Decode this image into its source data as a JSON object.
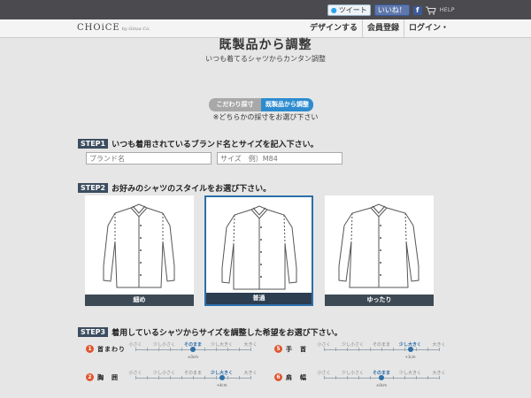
{
  "topbar": {
    "tweet_label": "ツイート",
    "like_label": "いいね！",
    "fb_glyph": "f",
    "help_label": "HELP"
  },
  "header": {
    "logo": "CHOiCE",
    "logo_tag": "by Ginza Co.",
    "nav": [
      "デザインする",
      "会員登録",
      "ログイン・"
    ]
  },
  "page": {
    "title": "既製品から調整",
    "subtitle": "いつも着てるシャツからカンタン調整"
  },
  "toggle": {
    "options": [
      "こだわり採寸",
      "既製品から調整"
    ],
    "selected_index": 1,
    "note": "※どちらかの採寸をお選び下さい"
  },
  "step1": {
    "badge": "STEP1",
    "text": "いつも着用されているブランド名とサイズを記入下さい。",
    "brand_placeholder": "ブランド名",
    "size_placeholder": "サイズ　例）M84"
  },
  "step2": {
    "badge": "STEP2",
    "text": "お好みのシャツのスタイルをお選び下さい。",
    "styles": [
      "細め",
      "普通",
      "ゆったり"
    ],
    "selected_index": 1
  },
  "step3": {
    "badge": "STEP3",
    "text": "着用しているシャツからサイズを調整した希望をお選び下さい。",
    "scale": [
      "小さく",
      "少し小さく",
      "そのまま",
      "少し大きく",
      "大きく"
    ],
    "rows": [
      {
        "num": "1",
        "name": "首まわり",
        "selected": 2,
        "note": "±0cm"
      },
      {
        "num": "5",
        "name": "手　首",
        "selected": 3,
        "note": "+1cm"
      },
      {
        "num": "2",
        "name": "胸　囲",
        "selected": 3,
        "note": "+4cm"
      },
      {
        "num": "6",
        "name": "肩　幅",
        "selected": 2,
        "note": "±0cm"
      }
    ]
  },
  "colors": {
    "accent": "#2d8ccf",
    "step_badge": "#3b4d5f",
    "number_badge": "#e0552f"
  }
}
